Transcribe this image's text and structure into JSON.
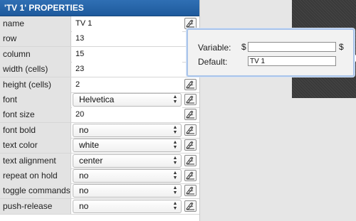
{
  "panel": {
    "title": "'TV 1' PROPERTIES",
    "rows": [
      {
        "label": "name",
        "value": "TV 1",
        "kind": "text",
        "var_button": true
      },
      {
        "label": "row",
        "value": "13",
        "kind": "text",
        "var_button": false
      },
      {
        "label": "column",
        "value": "15",
        "kind": "text",
        "var_button": false
      },
      {
        "label": "width (cells)",
        "value": "23",
        "kind": "text",
        "var_button": false
      },
      {
        "label": "height (cells)",
        "value": "2",
        "kind": "text",
        "var_button": true
      },
      {
        "label": "font",
        "value": "Helvetica",
        "kind": "select",
        "var_button": true
      },
      {
        "label": "font size",
        "value": "20",
        "kind": "text",
        "var_button": true
      },
      {
        "label": "font bold",
        "value": "no",
        "kind": "select",
        "var_button": true
      },
      {
        "label": "text color",
        "value": "white",
        "kind": "select",
        "var_button": true
      },
      {
        "label": "text alignment",
        "value": "center",
        "kind": "select",
        "var_button": true
      },
      {
        "label": "repeat on hold",
        "value": "no",
        "kind": "select",
        "var_button": true
      },
      {
        "label": "toggle commands",
        "value": "no",
        "kind": "select",
        "var_button": true
      },
      {
        "label": "push-release",
        "value": "no",
        "kind": "select",
        "var_button": true
      }
    ]
  },
  "popup": {
    "variable_label": "Variable:",
    "dollar_prefix": "$",
    "dollar_suffix": "$",
    "variable_value": "",
    "default_label": "Default:",
    "default_value": "TV 1"
  },
  "icons": {
    "variable_button": "variable-edit-icon",
    "select_arrows": "updown-arrows-icon"
  },
  "colors": {
    "title_bar": "#2f6fb4",
    "popup_border": "#a9c4ea"
  }
}
